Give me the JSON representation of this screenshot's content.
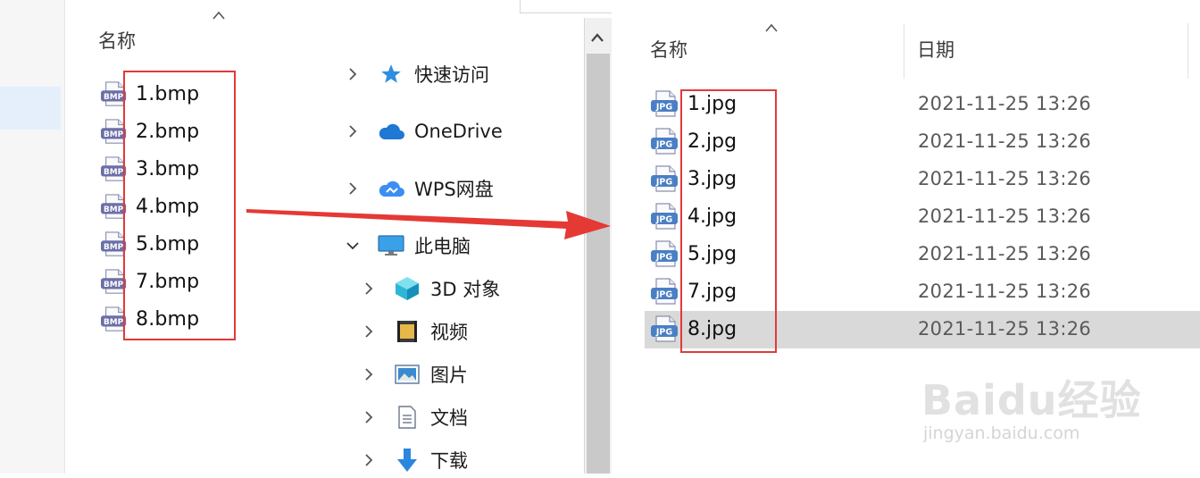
{
  "left_window": {
    "column_header": "名称",
    "files": [
      {
        "name": "1.bmp",
        "icon": "bmp-file-icon"
      },
      {
        "name": "2.bmp",
        "icon": "bmp-file-icon"
      },
      {
        "name": "3.bmp",
        "icon": "bmp-file-icon"
      },
      {
        "name": "4.bmp",
        "icon": "bmp-file-icon"
      },
      {
        "name": "5.bmp",
        "icon": "bmp-file-icon"
      },
      {
        "name": "7.bmp",
        "icon": "bmp-file-icon"
      },
      {
        "name": "8.bmp",
        "icon": "bmp-file-icon"
      }
    ],
    "icon_text": "BMP"
  },
  "nav_tree": [
    {
      "label": "快速访问",
      "icon": "star-icon",
      "expanded": false
    },
    {
      "label": "OneDrive",
      "icon": "cloud-icon",
      "expanded": false
    },
    {
      "label": "WPS网盘",
      "icon": "wps-cloud-icon",
      "expanded": false
    },
    {
      "label": "此电脑",
      "icon": "computer-icon",
      "expanded": true
    },
    {
      "label": "3D 对象",
      "icon": "cube-3d-icon",
      "expanded": false
    },
    {
      "label": "视频",
      "icon": "video-icon",
      "expanded": false
    },
    {
      "label": "图片",
      "icon": "picture-icon",
      "expanded": false
    },
    {
      "label": "文档",
      "icon": "document-icon",
      "expanded": false
    },
    {
      "label": "下载",
      "icon": "download-icon",
      "expanded": false
    }
  ],
  "right_window": {
    "column_name": "名称",
    "column_date": "日期",
    "icon_text": "JPG",
    "files": [
      {
        "name": "1.jpg",
        "date": "2021-11-25 13:26",
        "selected": false
      },
      {
        "name": "2.jpg",
        "date": "2021-11-25 13:26",
        "selected": false
      },
      {
        "name": "3.jpg",
        "date": "2021-11-25 13:26",
        "selected": false
      },
      {
        "name": "4.jpg",
        "date": "2021-11-25 13:26",
        "selected": false
      },
      {
        "name": "5.jpg",
        "date": "2021-11-25 13:26",
        "selected": false
      },
      {
        "name": "7.jpg",
        "date": "2021-11-25 13:26",
        "selected": false
      },
      {
        "name": "8.jpg",
        "date": "2021-11-25 13:26",
        "selected": true
      }
    ]
  },
  "colors": {
    "highlight_box": "#e03a3a",
    "arrow": "#e53935",
    "selection": "#d9d9d9"
  },
  "watermark": {
    "brand": "Baidu经验",
    "url": "jingyan.baidu.com"
  }
}
